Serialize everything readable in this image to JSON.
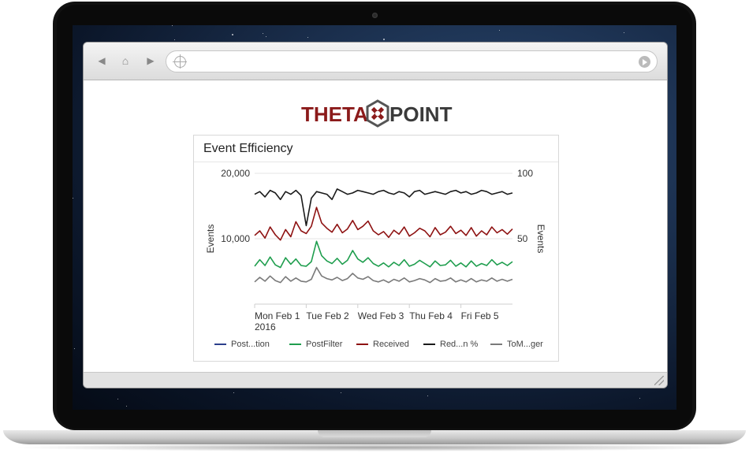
{
  "browser": {
    "address_value": ""
  },
  "page": {
    "logo_text_left": "THETA",
    "logo_text_right": "POINT",
    "panel_title": "Event Efficiency"
  },
  "chart_data": {
    "type": "line",
    "title": "Event Efficiency",
    "ylabel": "Events",
    "y2label": "Events",
    "ylim": [
      0,
      20000
    ],
    "y2lim": [
      0,
      100
    ],
    "y_ticks": [
      "20,000",
      "10,000"
    ],
    "y2_ticks": [
      "100",
      "50"
    ],
    "x_ticks": [
      "Mon Feb 1\n2016",
      "Tue Feb 2",
      "Wed Feb 3",
      "Thu Feb 4",
      "Fri Feb 5"
    ],
    "x_tick_lines": [
      [
        "Mon Feb 1",
        "2016"
      ],
      [
        "Tue Feb 2"
      ],
      [
        "Wed Feb 3"
      ],
      [
        "Thu Feb 4"
      ],
      [
        "Fri Feb 5"
      ]
    ],
    "legend": [
      "Post...tion",
      "PostFilter",
      "Received",
      "Red...n %",
      "ToM...ger"
    ],
    "colors": {
      "Post...tion": "#2b3f8c",
      "PostFilter": "#1f9e4e",
      "Received": "#8e1212",
      "Red...n %": "#1a1a1a",
      "ToM...ger": "#7a7a7a"
    },
    "series": [
      {
        "name": "Red...n %",
        "axis": "right",
        "values": [
          84,
          86,
          82,
          87,
          85,
          80,
          86,
          84,
          87,
          83,
          60,
          81,
          86,
          85,
          84,
          80,
          88,
          86,
          84,
          85,
          87,
          86,
          85,
          84,
          86,
          87,
          85,
          84,
          86,
          85,
          82,
          86,
          87,
          84,
          85,
          86,
          85,
          84,
          86,
          87,
          85,
          86,
          84,
          85,
          87,
          86,
          84,
          85,
          86,
          84,
          85
        ]
      },
      {
        "name": "Received",
        "axis": "left",
        "values": [
          10500,
          11200,
          10100,
          11800,
          10600,
          9800,
          11400,
          10300,
          12600,
          11200,
          10800,
          11900,
          14800,
          12400,
          11600,
          11000,
          12200,
          10900,
          11500,
          12800,
          11400,
          11900,
          12700,
          11200,
          10600,
          11100,
          10200,
          11300,
          10700,
          11800,
          10400,
          10900,
          11600,
          11200,
          10300,
          11700,
          10600,
          11000,
          11900,
          10800,
          11300,
          10500,
          11700,
          10400,
          11200,
          10600,
          11800,
          10900,
          11400,
          10700,
          11500
        ]
      },
      {
        "name": "PostFilter",
        "axis": "left",
        "values": [
          5800,
          6800,
          5900,
          7200,
          6000,
          5600,
          7100,
          6100,
          6900,
          5900,
          5800,
          6500,
          9600,
          7400,
          6600,
          6200,
          7000,
          6100,
          6700,
          8200,
          6900,
          6400,
          7100,
          6200,
          5800,
          6300,
          5700,
          6400,
          5900,
          6800,
          5800,
          6100,
          6700,
          6200,
          5700,
          6600,
          5900,
          6000,
          6700,
          5800,
          6300,
          5700,
          6600,
          5800,
          6200,
          5900,
          6800,
          6000,
          6400,
          5900,
          6500
        ]
      },
      {
        "name": "ToM...ger",
        "axis": "left",
        "values": [
          3400,
          4100,
          3500,
          4300,
          3600,
          3300,
          4200,
          3500,
          4000,
          3500,
          3400,
          3800,
          5600,
          4300,
          3900,
          3700,
          4100,
          3600,
          3900,
          4700,
          4000,
          3800,
          4200,
          3600,
          3400,
          3700,
          3300,
          3800,
          3500,
          4000,
          3400,
          3600,
          3900,
          3700,
          3300,
          3900,
          3500,
          3600,
          4000,
          3400,
          3700,
          3400,
          3900,
          3400,
          3700,
          3500,
          4000,
          3500,
          3800,
          3500,
          3800
        ]
      }
    ],
    "grid": "horizontal",
    "legend_position": "bottom"
  }
}
